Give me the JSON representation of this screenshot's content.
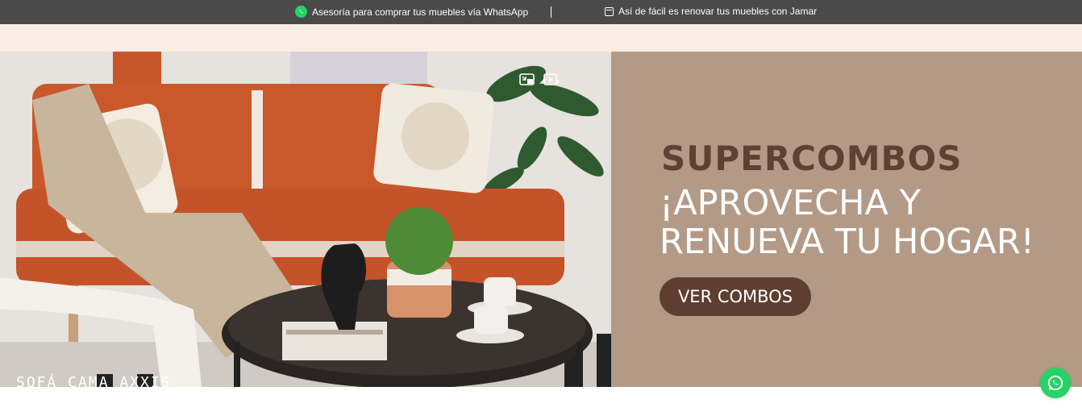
{
  "topbar": {
    "whatsapp_text": "Asesoría para comprar tus muebles vía WhatsApp",
    "renovate_text": "Así de fácil es renovar tus muebles con Jamar"
  },
  "hero": {
    "headline": "SUPERCOMBOS",
    "subline_1": "¡APROVECHA Y",
    "subline_2": "RENUEVA TU HOGAR!",
    "button_label": "VER COMBOS",
    "caption": "SOFÁ CAMA AXXIS"
  },
  "colors": {
    "topbar_bg": "#4a4a4a",
    "cream_bar": "#faeee4",
    "promo_bg": "#b39a87",
    "headline": "#5b4234",
    "button_bg": "#5e3e30",
    "whatsapp_green": "#25d366",
    "sofa_orange": "#c9582a"
  },
  "icons": [
    "whatsapp-icon",
    "calendar-icon",
    "exit-picture-icon",
    "video-icon",
    "whatsapp-float-icon"
  ]
}
